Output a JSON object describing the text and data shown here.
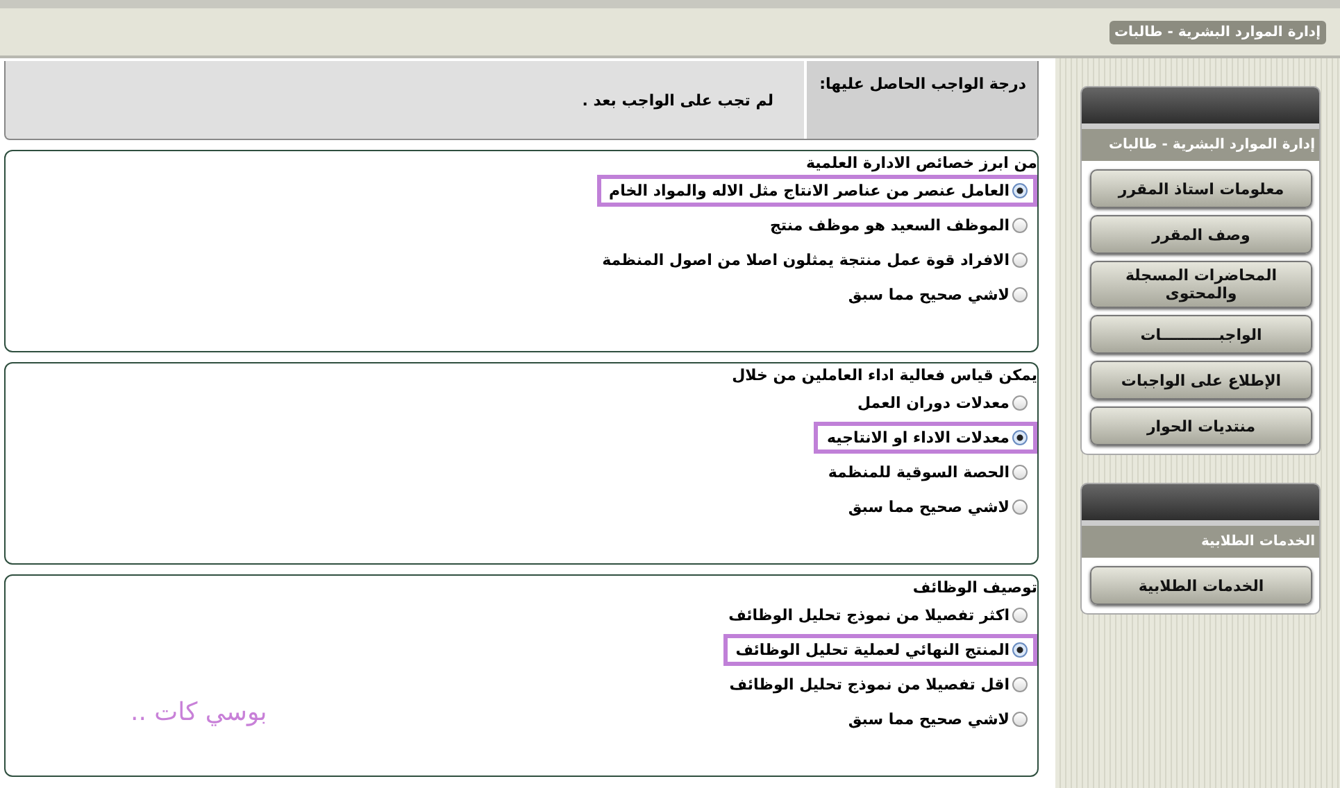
{
  "header": {
    "title": "إدارة الموارد البشرية - طالبات"
  },
  "grade": {
    "label": "درجة الواجب الحاصل عليها:",
    "value": "لم تجب على الواجب بعد ."
  },
  "questions": [
    {
      "text": "من ابرز خصائص الادارة العلمية",
      "options": [
        {
          "label": "العامل عنصر من عناصر الانتاج مثل الاله والمواد الخام",
          "selected": true
        },
        {
          "label": "الموظف السعيد هو موظف منتج",
          "selected": false
        },
        {
          "label": "الافراد قوة عمل منتجة يمثلون اصلا من اصول المنظمة",
          "selected": false
        },
        {
          "label": "لاشي صحيح مما سبق",
          "selected": false
        }
      ]
    },
    {
      "text": "يمكن قياس فعالية اداء العاملين من خلال",
      "options": [
        {
          "label": "معدلات دوران العمل",
          "selected": false
        },
        {
          "label": "معدلات الاداء او الانتاجيه",
          "selected": true
        },
        {
          "label": "الحصة السوقية للمنظمة",
          "selected": false
        },
        {
          "label": "لاشي صحيح مما سبق",
          "selected": false
        }
      ]
    },
    {
      "text": "توصيف الوظائف",
      "options": [
        {
          "label": "اكثر تفصيلا من نموذج تحليل الوظائف",
          "selected": false
        },
        {
          "label": "المنتج النهائي لعملية تحليل الوظائف",
          "selected": true
        },
        {
          "label": "اقل تفصيلا من نموذج تحليل الوظائف",
          "selected": false
        },
        {
          "label": "لاشي صحيح مما سبق",
          "selected": false
        }
      ]
    }
  ],
  "signature": "بوسي كات ..",
  "sidebar": [
    {
      "title": "إدارة الموارد البشرية - طالبات",
      "items": [
        "معلومات استاذ المقرر",
        "وصف المقرر",
        "المحاضرات المسجلة والمحتوى",
        "الواجبـــــــــــات",
        "الإطلاع على الواجبات",
        "منتديات الحوار"
      ]
    },
    {
      "title": "الخدمات الطلابية",
      "items": [
        "الخدمات الطلابية"
      ]
    }
  ]
}
